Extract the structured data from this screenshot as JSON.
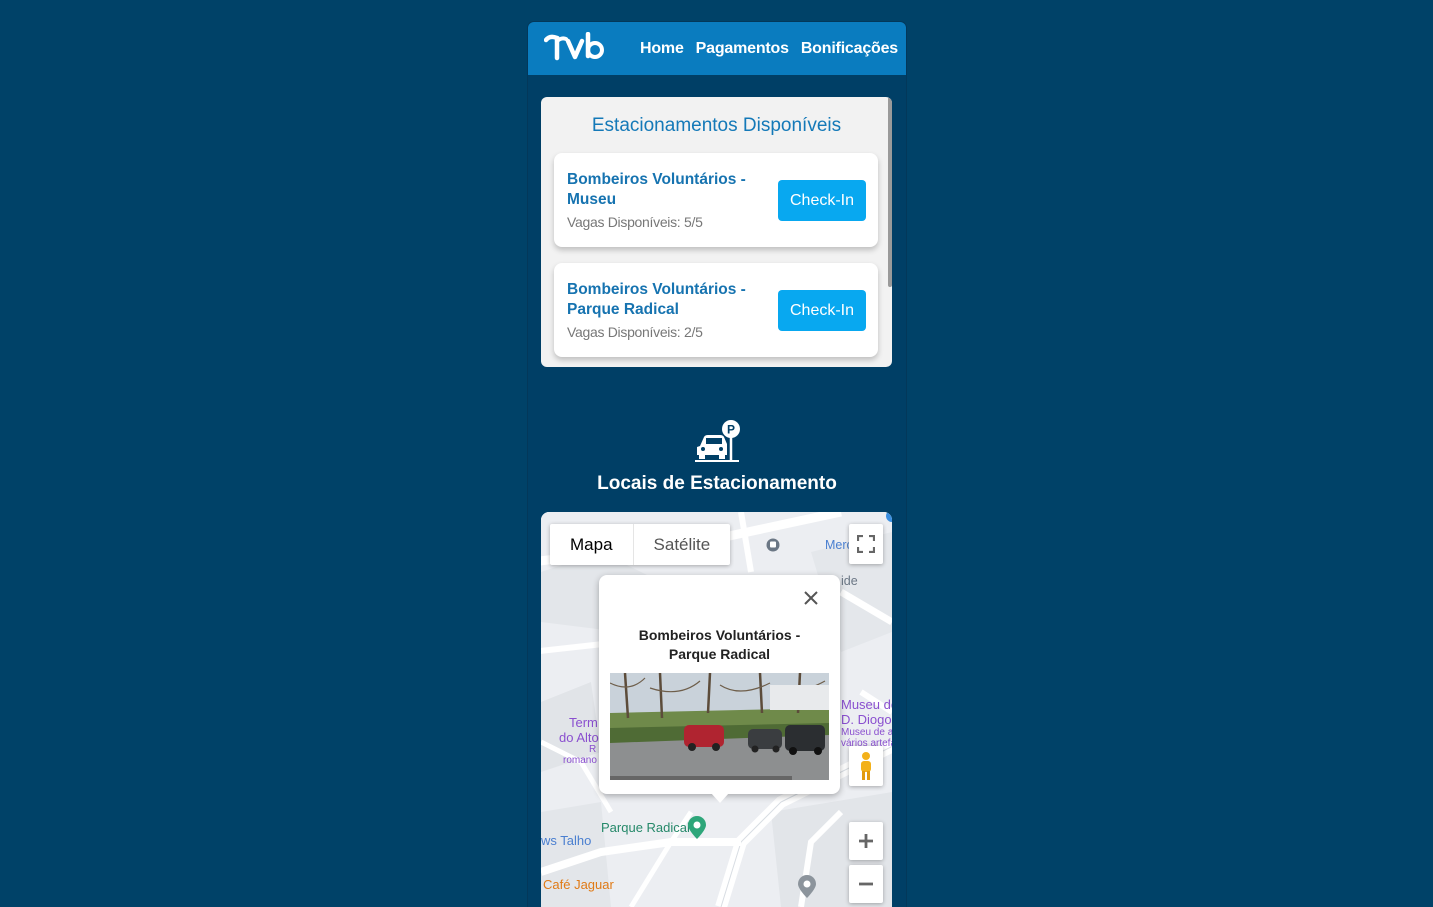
{
  "nav": {
    "logo_text": "rub",
    "links": [
      "Home",
      "Pagamentos",
      "Bonificações"
    ]
  },
  "list": {
    "title": "Estacionamentos Disponíveis",
    "items": [
      {
        "name": "Bombeiros Voluntários - Museu",
        "vagas": "Vagas Disponíveis: 5/5",
        "button": "Check-In"
      },
      {
        "name": "Bombeiros Voluntários - Parque Radical",
        "vagas": "Vagas Disponíveis: 2/5",
        "button": "Check-In"
      }
    ]
  },
  "section": {
    "icon": "parking-car-icon",
    "title": "Locais de Estacionamento"
  },
  "map": {
    "types": [
      "Mapa",
      "Satélite"
    ],
    "selected_type": "Mapa",
    "info_window": {
      "title": "Bombeiros Voluntários - Parque Radical"
    },
    "labels": {
      "merc": "Merc",
      "ide": "ide",
      "terminal_1": "Term",
      "terminal_2": "do Alto",
      "terminal_3": "R",
      "terminal_4": "romano",
      "museu_1": "Museu de",
      "museu_2": "D. Diogo",
      "museu_3": "Museu de a",
      "museu_4": "vários artefa",
      "parque_radical": "Parque Radical",
      "talho": "ws Talho",
      "cafe": "Café Jaguar"
    }
  },
  "colors": {
    "background": "#004268",
    "navbar": "#0a7cbf",
    "accent": "#08a8f0",
    "title_blue": "#1479b8"
  }
}
